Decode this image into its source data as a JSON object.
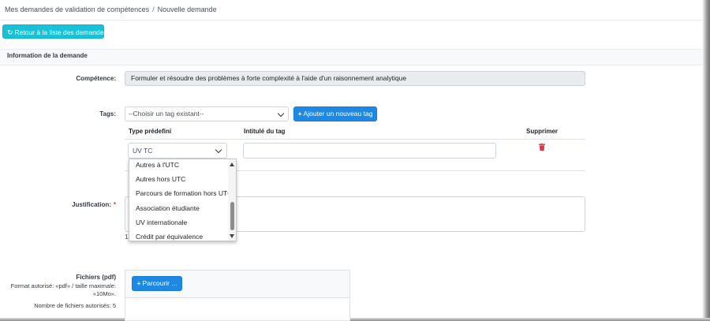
{
  "breadcrumb": {
    "items": [
      "Mes demandes de validation de compétences",
      "Nouvelle demande"
    ],
    "separator": "/"
  },
  "back_button": {
    "icon": "refresh-icon",
    "label": "Retour à la liste des demandes"
  },
  "section": {
    "title": "Information de la demande"
  },
  "competence": {
    "label": "Compétence:",
    "value": "Formuler et résoudre des problèmes à forte complexité à l'aide d'un raisonnement analytique"
  },
  "tags": {
    "label": "Tags:",
    "select_value": "--Choisir un tag existant--",
    "add_button": "Ajouter un nouveau tag",
    "columns": {
      "type": "Type prédefini",
      "intitule": "Intitulé du tag",
      "supprimer": "Supprimer"
    },
    "row": {
      "type_value": "UV TC",
      "intitule_value": ""
    },
    "dropdown_options": [
      "Autres à l'UTC",
      "Autres hors UTC",
      "Parcours de formation hors UTC",
      "Association étudiante",
      "UV internationale",
      "Crédit par équivalence"
    ]
  },
  "justification": {
    "label": "Justification:",
    "required_mark": "*",
    "stray_text": "1"
  },
  "files": {
    "label": "Fichiers (pdf)",
    "format_note": "Format autorisé: «pdf» / taille maximale: «10Mo».",
    "count_note": "Nombre de fichiers autorisés: 5",
    "browse_button": "Parcourir ..."
  },
  "colors": {
    "back_button": "#17c1d8",
    "primary_button": "#1e88e5",
    "delete_icon": "#dc3545",
    "readonly_field": "#e9ecef"
  }
}
